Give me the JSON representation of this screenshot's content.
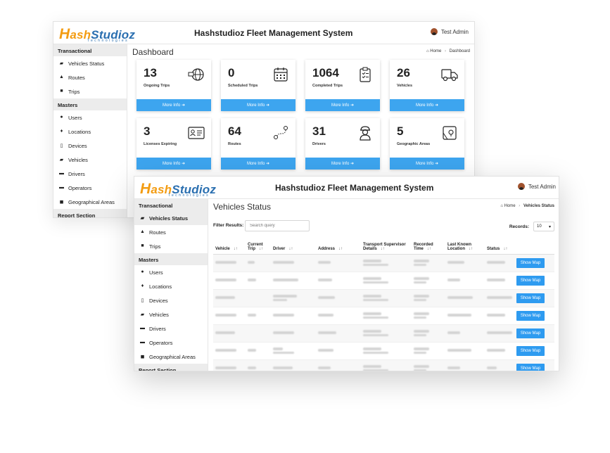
{
  "app": {
    "logo_h": "H",
    "logo_ash": "ash",
    "logo_studioz": "Studioz",
    "logo_tagline": "Technologies",
    "title": "Hashstudioz Fleet Management System",
    "user": "Test Admin"
  },
  "sidebar": {
    "transactional": "Transactional",
    "items_trans": [
      "Vehicles Status",
      "Routes",
      "Trips"
    ],
    "masters": "Masters",
    "items_masters": [
      "Users",
      "Locations",
      "Devices",
      "Vehicles",
      "Drivers",
      "Operators",
      "Geographical Areas"
    ],
    "report": "Report Section",
    "icons_trans": [
      "car-icon",
      "road-icon",
      "truck-icon"
    ],
    "icons_masters": [
      "user-icon",
      "map-marker-icon",
      "mobile-icon",
      "car-icon",
      "id-card-icon",
      "id-card-icon",
      "map-icon"
    ]
  },
  "dashboard": {
    "page_title": "Dashboard",
    "crumb_home": "Home",
    "crumb_current": "Dashboard",
    "more_info": "More Info",
    "cards": [
      {
        "value": "13",
        "label": "Ongoing Trips",
        "icon": "globe-truck-icon"
      },
      {
        "value": "0",
        "label": "Scheduled Trips",
        "icon": "calendar-icon"
      },
      {
        "value": "1064",
        "label": "Completed Trips",
        "icon": "clipboard-check-icon"
      },
      {
        "value": "26",
        "label": "Vehicles",
        "icon": "truck-icon"
      },
      {
        "value": "3",
        "label": "Licenses Expiring",
        "icon": "license-card-icon"
      },
      {
        "value": "64",
        "label": "Routes",
        "icon": "route-icon"
      },
      {
        "value": "31",
        "label": "Drivers",
        "icon": "driver-icon"
      },
      {
        "value": "5",
        "label": "Geographic Areas",
        "icon": "map-pin-icon"
      }
    ]
  },
  "vehicles_status": {
    "page_title": "Vehicles Status",
    "crumb_home": "Home",
    "crumb_current": "Vehicles Status",
    "filter_label": "Filter Results:",
    "search_placeholder": "Search query",
    "records_label": "Records:",
    "records_value": "10",
    "columns": [
      "Vehicle",
      "Current Trip",
      "Driver",
      "Address",
      "Transport Supervisor Details",
      "Recorded Time",
      "Last Known Location",
      "Status"
    ],
    "show_map": "Show Map",
    "row_count": 7
  }
}
